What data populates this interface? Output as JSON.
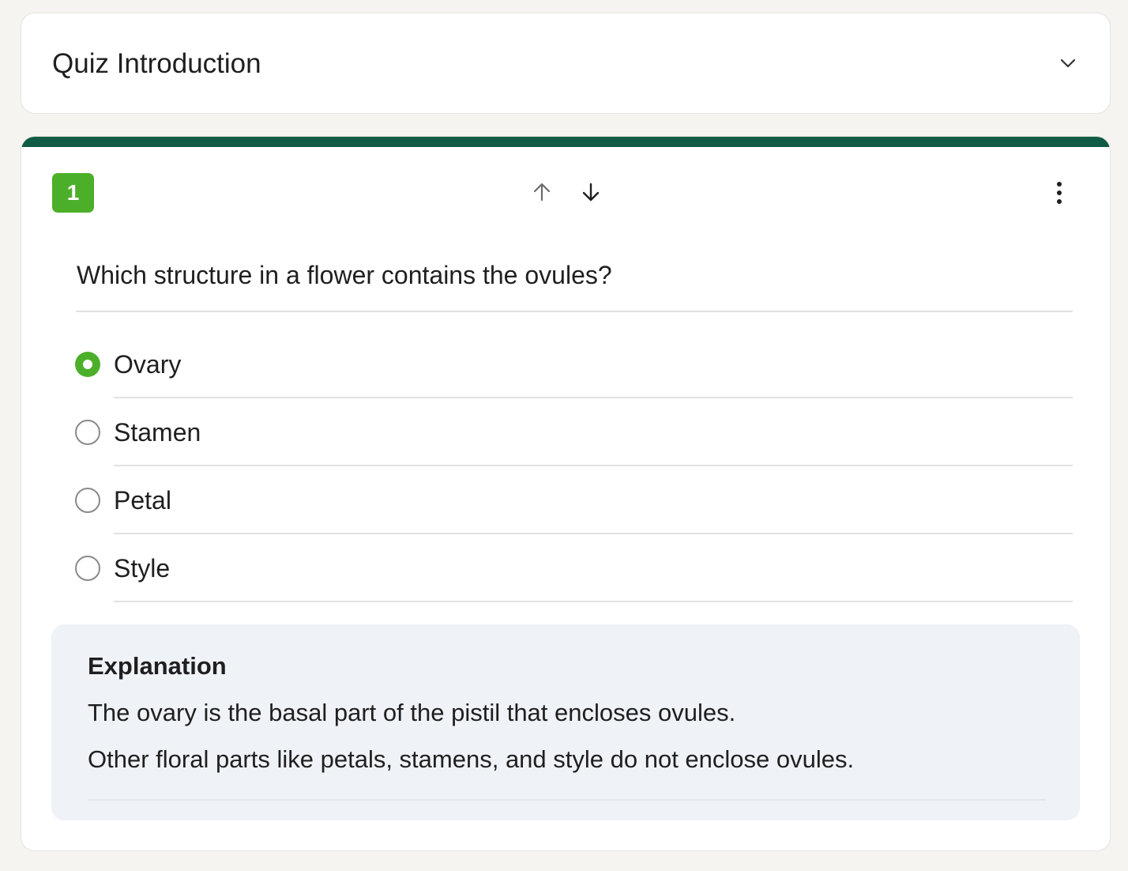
{
  "colors": {
    "accent_bar": "#0f5b45",
    "number_badge": "#4caf2a",
    "selected_radio": "#4caf2a"
  },
  "intro": {
    "title": "Quiz Introduction",
    "toggle_icon": "chevron-down-icon"
  },
  "question": {
    "number": "1",
    "move_up_icon": "arrow-up-icon",
    "move_down_icon": "arrow-down-icon",
    "more_icon": "more-vertical-icon",
    "text": "Which structure in a flower contains the ovules?",
    "selected_option": "Ovary",
    "options": [
      {
        "label": "Ovary",
        "selected": true
      },
      {
        "label": "Stamen",
        "selected": false
      },
      {
        "label": "Petal",
        "selected": false
      },
      {
        "label": "Style",
        "selected": false
      }
    ]
  },
  "explanation": {
    "title": "Explanation",
    "lines": [
      "The ovary is the basal part of the pistil that encloses ovules.",
      "Other floral parts like petals, stamens, and style do not enclose ovules."
    ]
  }
}
